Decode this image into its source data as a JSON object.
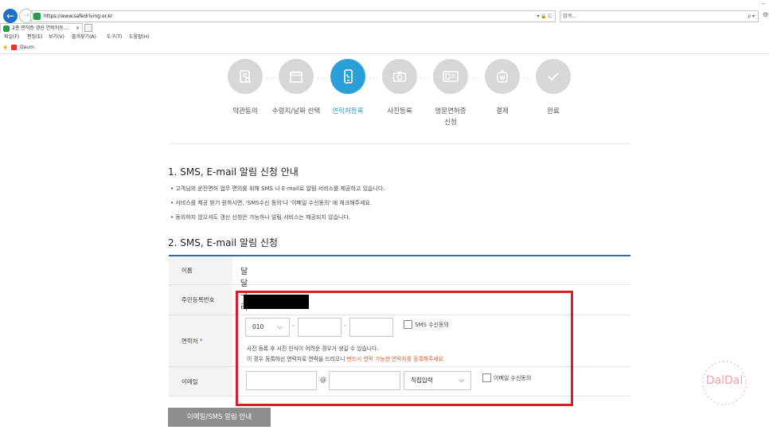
{
  "browser": {
    "url": "https://www.safedriving.or.kr",
    "address_tools": "▾ 🔒 C",
    "search_placeholder": "검색...",
    "search_tools": "ρ ▾",
    "tab_title": "2종 면허증 갱신 연락처등...",
    "tab_close": "×",
    "menus": [
      "파일(F)",
      "편집(E)",
      "보기(V)",
      "즐겨찾기(A)",
      "도구(T)",
      "도움말(H)"
    ],
    "favorites": [
      "Daum"
    ]
  },
  "steps": [
    {
      "label": "약관동의",
      "icon": "document-icon",
      "active": false
    },
    {
      "label": "수령지/날짜 선택",
      "icon": "calendar-icon",
      "active": false
    },
    {
      "label": "연락처등록",
      "icon": "phone-icon",
      "active": true
    },
    {
      "label": "사진등록",
      "icon": "camera-icon",
      "active": false
    },
    {
      "label": "영문면허증\n신청",
      "icon": "id-card-icon",
      "active": false
    },
    {
      "label": "결제",
      "icon": "wallet-icon",
      "active": false
    },
    {
      "label": "완료",
      "icon": "check-icon",
      "active": false
    }
  ],
  "section1": {
    "title": "1. SMS, E-mail 알림 신청 안내",
    "bullets": [
      "• 고객님의 운전면허 업무 편의를 위해 SMS 나 E-mail로 알림 서비스를 제공하고 있습니다.",
      "• 서비스를 제공 받기 원하시면, 'SMS수신 동의'나 '이메일 수신동의' 에 체크해주세요.",
      "• 동의하지 않으셔도 갱신 신청은 가능하나 알림 서비스는 제공되지 않습니다."
    ]
  },
  "section2": {
    "title": "2. SMS, E-mail 알림 신청",
    "name_label": "이름",
    "name_value": "달달구리",
    "rrn_label": "주민등록번호",
    "phone_label": "연락처",
    "phone_required": "*",
    "phone_prefix": "010",
    "phone_dash": "-",
    "sms_consent": "SMS 수신동의",
    "phone_note1": "사진 등록 후 사진 인식이 어려운 경우가 생길 수 있습니다.",
    "phone_note2_prefix": "이 경우 등록하신 연락처로 연락을 드리오니 ",
    "phone_note2_highlight": "반드시 연락 가능한 연락처를 등록해주세요",
    "email_label": "이메일",
    "email_at": "@",
    "email_select": "직접입력",
    "email_consent": "이메일 수신동의"
  },
  "info_button": "이메일/SMS 알림 안내",
  "watermark": "DalDal",
  "colors": {
    "accent": "#2a9fd8",
    "highlight": "#d71f26",
    "note": "#e05a2b"
  }
}
